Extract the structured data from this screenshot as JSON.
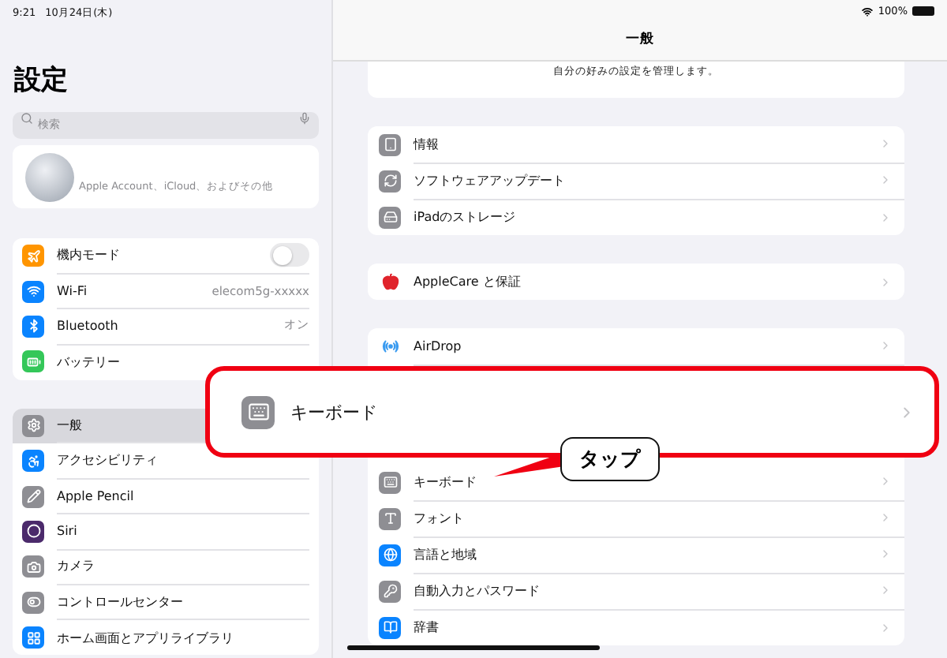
{
  "status_bar": {
    "time": "9:21",
    "date": "10月24日(木)",
    "battery": "100%"
  },
  "sidebar": {
    "title": "設定",
    "search": {
      "placeholder": "検索"
    },
    "account": {
      "text": "Apple Account、iCloud、およびその他"
    },
    "groups": [
      [
        {
          "label": "機内モード",
          "kind": "toggle",
          "on": false,
          "color": "#ff9500",
          "selected": false
        },
        {
          "label": "Wi-Fi",
          "kind": "value",
          "value": "elecom5g-xxxxx",
          "color": "#0a84ff",
          "selected": false
        },
        {
          "label": "Bluetooth",
          "kind": "value",
          "value": "オン",
          "color": "#0a84ff",
          "selected": false
        },
        {
          "label": "バッテリー",
          "kind": "plain",
          "color": "#34c759",
          "selected": false
        }
      ],
      [
        {
          "label": "一般",
          "kind": "plain",
          "color": "#8e8e93",
          "selected": true
        },
        {
          "label": "アクセシビリティ",
          "kind": "plain",
          "color": "#0a84ff",
          "selected": false
        },
        {
          "label": "Apple Pencil",
          "kind": "plain",
          "color": "#8e8e93",
          "selected": false
        },
        {
          "label": "Siri",
          "kind": "plain",
          "color": "#4b2a6b",
          "selected": false
        },
        {
          "label": "カメラ",
          "kind": "plain",
          "color": "#8e8e93",
          "selected": false
        },
        {
          "label": "コントロールセンター",
          "kind": "plain",
          "color": "#8e8e93",
          "selected": false
        },
        {
          "label": "ホーム画面とアプリライブラリ",
          "kind": "plain",
          "color": "#0a84ff",
          "selected": false
        }
      ]
    ]
  },
  "detail": {
    "title": "一般",
    "intro": "自分の好みの設定を管理します。",
    "groups": [
      [
        {
          "label": "情報",
          "color": "#8e8e93",
          "tile": true
        },
        {
          "label": "ソフトウェアアップデート",
          "color": "#8e8e93",
          "tile": true
        },
        {
          "label": "iPadのストレージ",
          "color": "#8e8e93",
          "tile": true
        }
      ],
      [
        {
          "label": "AppleCare と保証",
          "color": "#e0242c",
          "tile": false
        }
      ],
      [
        {
          "label": "AirDrop",
          "color": "#3a9bf0",
          "tile": false,
          "covered_after": true
        },
        {
          "label": "キーボード",
          "color": "#8e8e93",
          "tile": true
        },
        {
          "label": "フォント",
          "color": "#8e8e93",
          "tile": true
        },
        {
          "label": "言語と地域",
          "color": "#0a84ff",
          "tile": true
        },
        {
          "label": "自動入力とパスワード",
          "color": "#8e8e93",
          "tile": true
        },
        {
          "label": "辞書",
          "color": "#0a84ff",
          "tile": true
        }
      ]
    ]
  },
  "callout": {
    "row": {
      "label": "キーボード"
    },
    "text": "タップ"
  }
}
